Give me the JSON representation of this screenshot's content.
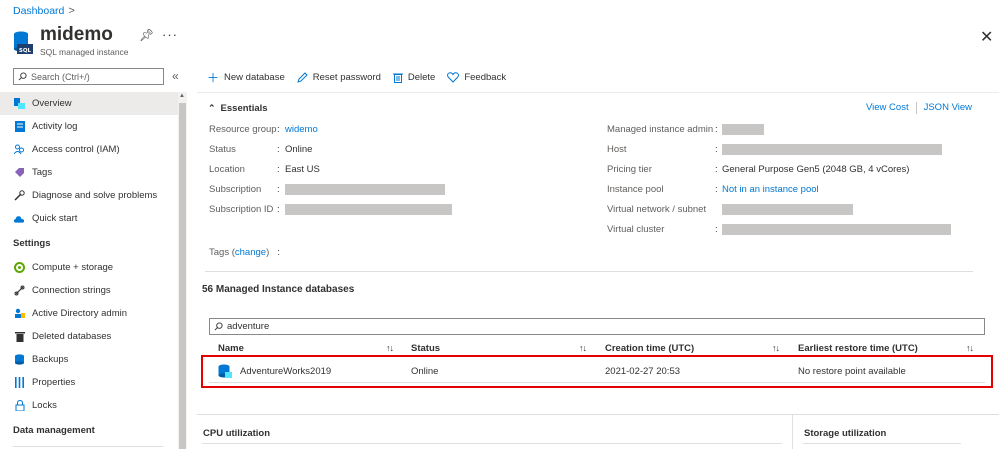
{
  "breadcrumb": {
    "root": "Dashboard",
    "separator": ">"
  },
  "resource": {
    "name": "midemo",
    "type": "SQL managed instance",
    "icon_text": "SQL"
  },
  "search": {
    "placeholder": "Search (Ctrl+/)"
  },
  "sidebar": {
    "items": [
      {
        "label": "Overview",
        "icon": "overview-icon"
      },
      {
        "label": "Activity log",
        "icon": "activity-log-icon"
      },
      {
        "label": "Access control (IAM)",
        "icon": "iam-icon"
      },
      {
        "label": "Tags",
        "icon": "tag-icon"
      },
      {
        "label": "Diagnose and solve problems",
        "icon": "wrench-icon"
      },
      {
        "label": "Quick start",
        "icon": "cloud-icon"
      }
    ],
    "settings_header": "Settings",
    "settings_items": [
      {
        "label": "Compute + storage",
        "icon": "compute-icon"
      },
      {
        "label": "Connection strings",
        "icon": "connection-icon"
      },
      {
        "label": "Active Directory admin",
        "icon": "ad-admin-icon"
      },
      {
        "label": "Deleted databases",
        "icon": "trash-icon"
      },
      {
        "label": "Backups",
        "icon": "backup-icon"
      },
      {
        "label": "Properties",
        "icon": "properties-icon"
      },
      {
        "label": "Locks",
        "icon": "lock-icon"
      }
    ],
    "data_header": "Data management"
  },
  "toolbar": {
    "new_database": "New database",
    "reset_password": "Reset password",
    "delete": "Delete",
    "feedback": "Feedback"
  },
  "essentials": {
    "title": "Essentials",
    "view_cost": "View Cost",
    "json_view": "JSON View",
    "left": {
      "resource_group_label": "Resource group",
      "resource_group_value": "widemo",
      "status_label": "Status",
      "status_value": "Online",
      "location_label": "Location",
      "location_value": "East US",
      "subscription_label": "Subscription",
      "subscription_id_label": "Subscription ID",
      "tags_label": "Tags",
      "tags_change": "change"
    },
    "right": {
      "admin_label": "Managed instance admin",
      "host_label": "Host",
      "pricing_label": "Pricing tier",
      "pricing_value": "General Purpose Gen5 (2048 GB, 4 vCores)",
      "pool_label": "Instance pool",
      "pool_value": "Not in an instance pool",
      "vnet_label": "Virtual network / subnet",
      "cluster_label": "Virtual cluster"
    }
  },
  "databases": {
    "title": "56 Managed Instance databases",
    "filter_value": "adventure",
    "columns": [
      "Name",
      "Status",
      "Creation time (UTC)",
      "Earliest restore time (UTC)"
    ],
    "rows": [
      {
        "name": "AdventureWorks2019",
        "status": "Online",
        "created": "2021-02-27 20:53",
        "restore": "No restore point available"
      }
    ]
  },
  "cards": {
    "cpu": "CPU utilization",
    "storage": "Storage utilization"
  },
  "colors": {
    "accent": "#0078d4",
    "highlight": "#e50000"
  }
}
